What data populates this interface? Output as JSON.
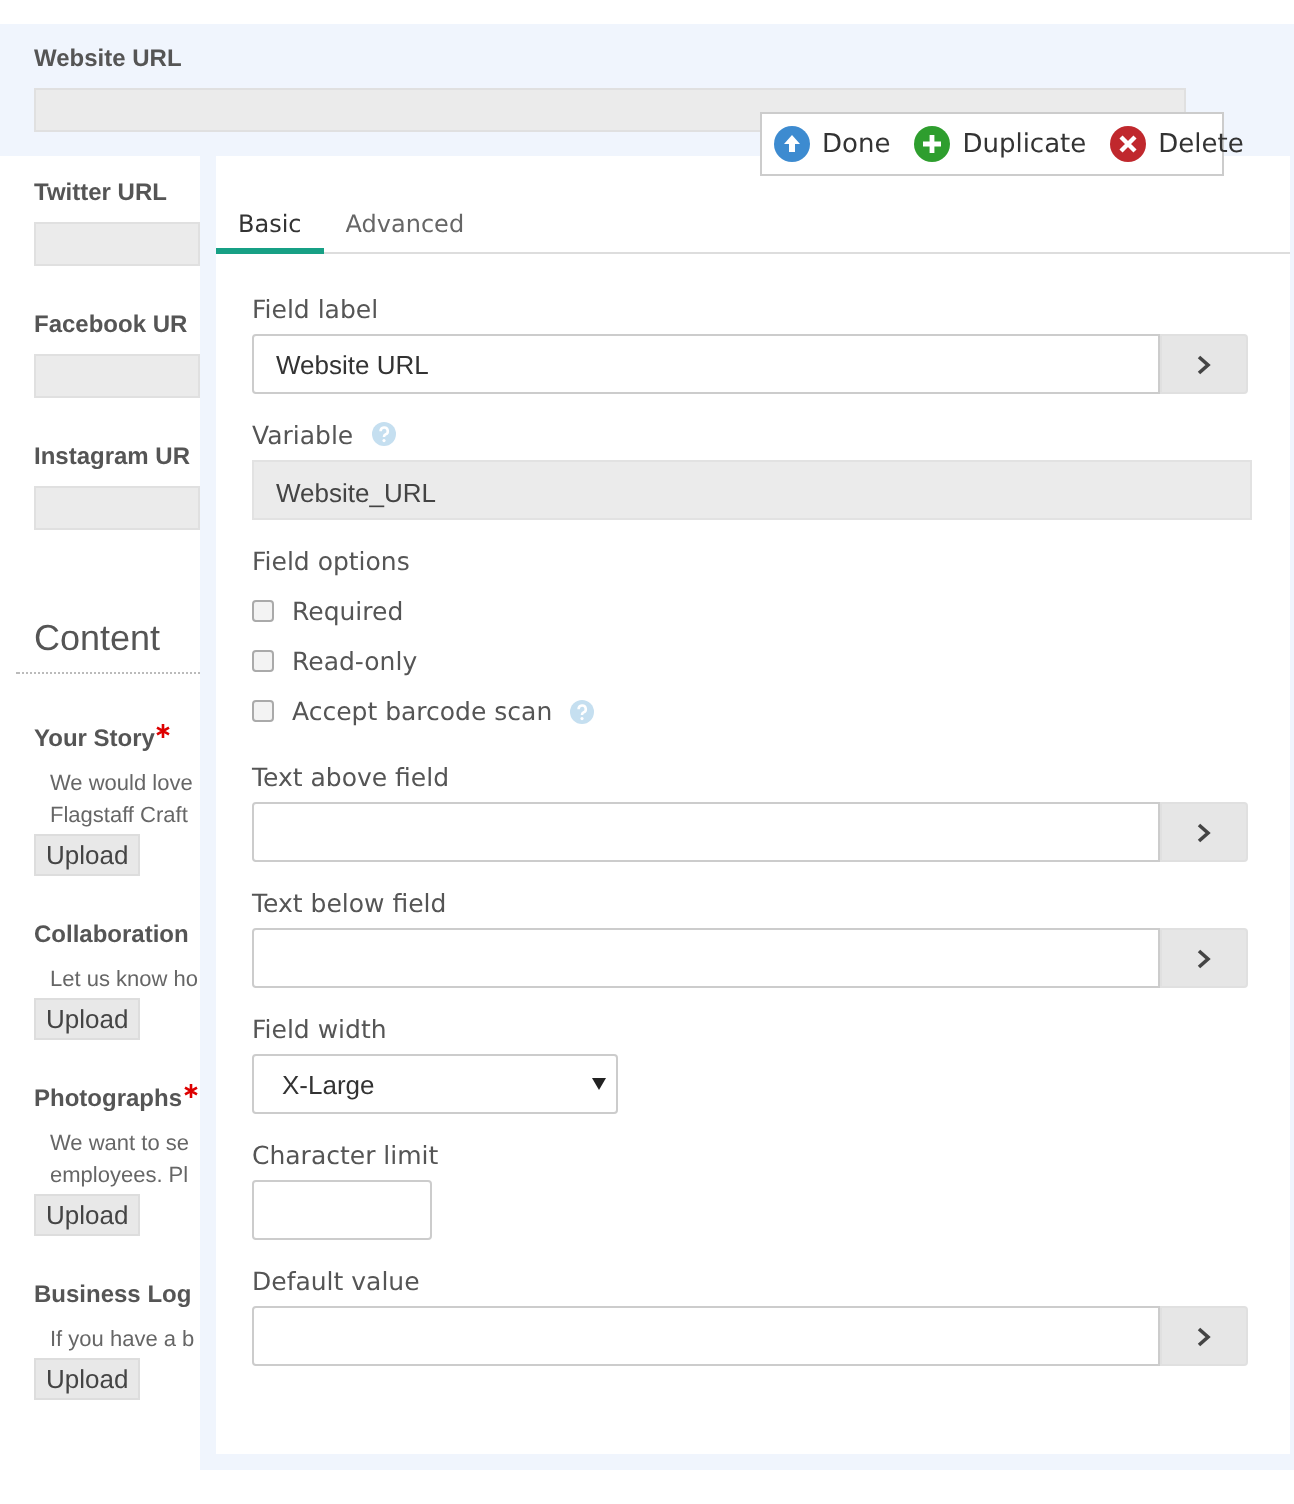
{
  "top_field": {
    "label": "Website URL"
  },
  "toolbar": [
    {
      "kind": "done",
      "label": "Done"
    },
    {
      "kind": "duplicate",
      "label": "Duplicate"
    },
    {
      "kind": "delete",
      "label": "Delete"
    }
  ],
  "background_form": {
    "url_fields": [
      {
        "label": "Twitter URL"
      },
      {
        "label": "Facebook UR"
      },
      {
        "label": "Instagram UR"
      }
    ],
    "section_title": "Content",
    "uploads": [
      {
        "label": "Your Story",
        "required": true,
        "description": [
          "We would love",
          "Flagstaff Craft"
        ],
        "button": "Upload"
      },
      {
        "label": "Collaboration",
        "required": false,
        "description": [
          "Let us know ho"
        ],
        "button": "Upload"
      },
      {
        "label": "Photographs",
        "required": true,
        "description": [
          "We want to se",
          "employees. Pl"
        ],
        "button": "Upload"
      },
      {
        "label": "Business Log",
        "required": false,
        "description": [
          "If you have a b"
        ],
        "button": "Upload"
      }
    ]
  },
  "editor": {
    "tabs": [
      {
        "label": "Basic",
        "selected": true
      },
      {
        "label": "Advanced",
        "selected": false
      }
    ],
    "fields": [
      {
        "kind": "input-button",
        "label": "Field label",
        "value": "Website URL"
      },
      {
        "kind": "readonly",
        "label": "Variable",
        "help": true,
        "value": "Website_URL"
      },
      {
        "kind": "options",
        "label": "Field options",
        "options": [
          {
            "label": "Required",
            "checked": false,
            "help": false
          },
          {
            "label": "Read-only",
            "checked": false,
            "help": false
          },
          {
            "label": "Accept barcode scan",
            "checked": false,
            "help": true
          }
        ]
      },
      {
        "kind": "input-button",
        "label": "Text above field"
      },
      {
        "kind": "input-button",
        "label": "Text below field"
      },
      {
        "kind": "select",
        "label": "Field width",
        "value": "X-Large"
      },
      {
        "kind": "small-input",
        "label": "Character limit"
      },
      {
        "kind": "input-button",
        "label": "Default value"
      }
    ]
  }
}
